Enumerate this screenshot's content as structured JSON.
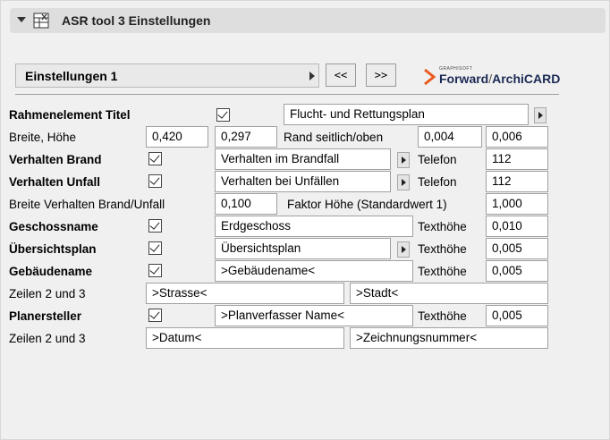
{
  "header": {
    "title": "ASR tool 3 Einstellungen"
  },
  "preset": {
    "label": "Einstellungen 1",
    "prev_label": "<<",
    "next_label": ">>"
  },
  "logo": {
    "small": "GRAPHISOFT",
    "brand": "Forward",
    "product": "ArchiCARD"
  },
  "rows": {
    "rahmen": {
      "label": "Rahmenelement Titel",
      "checked": true,
      "value": "Flucht- und Rettungsplan"
    },
    "breite": {
      "label": "Breite, Höhe",
      "width": "0,420",
      "height": "0,297",
      "rand_label": "Rand seitlich/oben",
      "rand_side": "0,004",
      "rand_top": "0,006"
    },
    "brand": {
      "label": "Verhalten Brand",
      "checked": true,
      "value": "Verhalten im Brandfall",
      "telefon_label": "Telefon",
      "telefon": "112"
    },
    "unfall": {
      "label": "Verhalten Unfall",
      "checked": true,
      "value": "Verhalten bei Unfällen",
      "telefon_label": "Telefon",
      "telefon": "112"
    },
    "breite_verhalten": {
      "label": "Breite Verhalten Brand/Unfall",
      "value": "0,100",
      "faktor_label": "Faktor Höhe (Standardwert 1)",
      "faktor": "1,000"
    },
    "geschoss": {
      "label": "Geschossname",
      "checked": true,
      "value": "Erdgeschoss",
      "texthoehe_label": "Texthöhe",
      "texthoehe": "0,010"
    },
    "uebersicht": {
      "label": "Übersichtsplan",
      "checked": true,
      "value": "Übersichtsplan",
      "texthoehe_label": "Texthöhe",
      "texthoehe": "0,005"
    },
    "gebaeude": {
      "label": "Gebäudename",
      "checked": true,
      "value": ">Gebäudename<",
      "texthoehe_label": "Texthöhe",
      "texthoehe": "0,005"
    },
    "zeilen1": {
      "label": "Zeilen 2 und 3",
      "line2": ">Strasse<",
      "line3": ">Stadt<"
    },
    "planer": {
      "label": "Planersteller",
      "checked": true,
      "value": ">Planverfasser Name<",
      "texthoehe_label": "Texthöhe",
      "texthoehe": "0,005"
    },
    "zeilen2": {
      "label": "Zeilen 2 und 3",
      "line2": ">Datum<",
      "line3": ">Zeichnungsnummer<"
    }
  },
  "icons": {
    "collapse": "triangle-down-icon",
    "settings": "settings-table-icon",
    "dropdown": "triangle-right-icon",
    "checkbox": "checkmark-icon"
  }
}
